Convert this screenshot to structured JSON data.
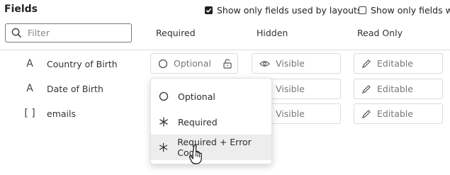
{
  "header": {
    "title": "Fields",
    "option_layouts": {
      "label": "Show only fields used by layouts",
      "checked": true
    },
    "option_other": {
      "label": "Show only fields with",
      "checked": false
    }
  },
  "filter": {
    "placeholder": "Filter",
    "icon": "search-icon"
  },
  "columns": {
    "required": "Required",
    "hidden": "Hidden",
    "read_only": "Read Only"
  },
  "rows": [
    {
      "type_icon": "A",
      "name": "Country of Birth",
      "required": "Optional",
      "hidden": "Visible",
      "read_only": "Editable"
    },
    {
      "type_icon": "A",
      "name": "Date of Birth",
      "hidden": "Visible",
      "read_only": "Editable"
    },
    {
      "type_icon": "[ ]",
      "name": "emails",
      "hidden": "Visible",
      "read_only": "Editable"
    }
  ],
  "menu": {
    "items": [
      {
        "label": "Optional",
        "icon": "circle-icon"
      },
      {
        "label": "Required",
        "icon": "asterisk-icon"
      },
      {
        "label": "Required + Error Code",
        "icon": "asterisk-icon"
      }
    ],
    "hovered_index": 2
  }
}
